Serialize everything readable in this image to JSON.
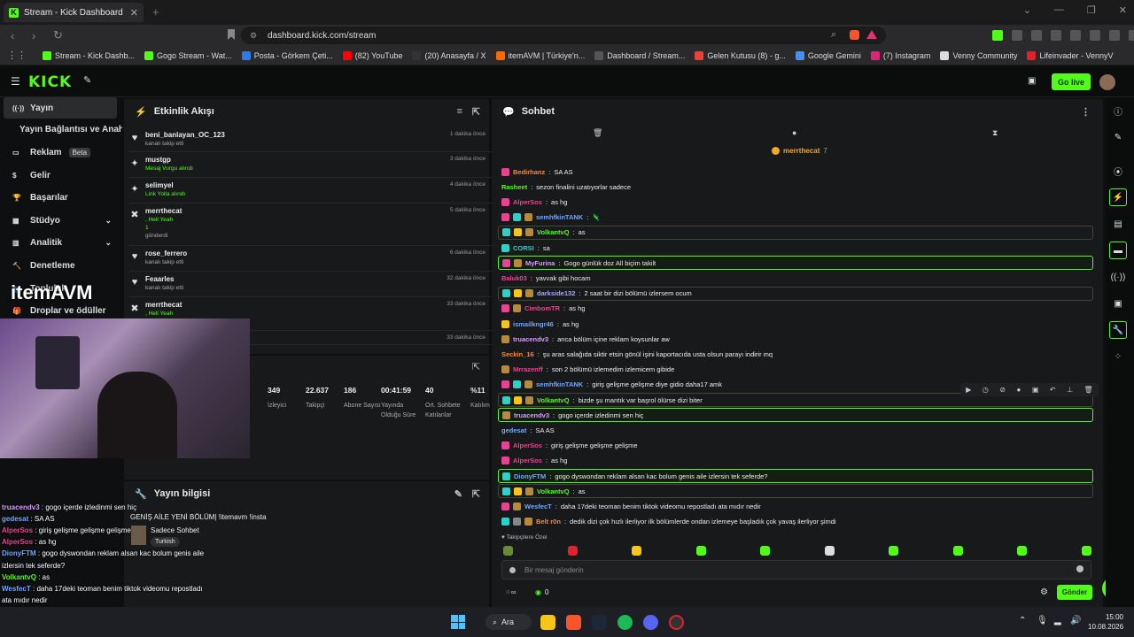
{
  "browser": {
    "tab_title": "Stream - Kick Dashboard",
    "url": "dashboard.kick.com/stream"
  },
  "bookmarks": [
    {
      "label": "Stream - Kick Dashb...",
      "color": "#53fc18"
    },
    {
      "label": "Gogo Stream - Wat...",
      "color": "#53fc18"
    },
    {
      "label": "Posta - Görkem Çeti...",
      "color": "#2d7be5"
    },
    {
      "label": "(82) YouTube",
      "color": "#ff0000"
    },
    {
      "label": "(20) Anasayfa / X",
      "color": "#333333"
    },
    {
      "label": "itemAVM | Türkiye'n...",
      "color": "#ff6a00"
    },
    {
      "label": "Dashboard / Stream...",
      "color": "#555555"
    },
    {
      "label": "Gelen Kutusu (8) - g...",
      "color": "#ea4335"
    },
    {
      "label": "Google Gemini",
      "color": "#4a8ef0"
    },
    {
      "label": "(7) Instagram",
      "color": "#d62976"
    },
    {
      "label": "Venny Community",
      "color": "#dddddd"
    },
    {
      "label": "Lifeinvader - VennyV",
      "color": "#e0222a"
    }
  ],
  "topnav": {
    "logo": "KICK",
    "go_live": "Go live"
  },
  "sidebar": {
    "items": [
      {
        "label": "Yayın",
        "icon": "broadcast-icon",
        "active": true
      },
      {
        "label": "Yayın Bağlantısı ve Anahtarı",
        "icon": ""
      },
      {
        "label": "Reklam",
        "icon": "ad-icon",
        "badge": "Beta"
      },
      {
        "label": "Gelir",
        "icon": "dollar-icon"
      },
      {
        "label": "Başarılar",
        "icon": "trophy-icon"
      },
      {
        "label": "Stüdyo",
        "icon": "studio-icon",
        "chevron": true
      },
      {
        "label": "Analitik",
        "icon": "chart-icon",
        "chevron": true
      },
      {
        "label": "Denetleme",
        "icon": "hammer-icon"
      },
      {
        "label": "Topluluk",
        "icon": "people-icon"
      },
      {
        "label": "Droplar ve ödüller",
        "icon": "gift-icon"
      }
    ]
  },
  "activity": {
    "title": "Etkinlik Akışı",
    "rows": [
      {
        "name": "beni_banlayan_OC_123",
        "sub": "kanalı takip etti",
        "time": "1 dakika önce",
        "icon": "♥"
      },
      {
        "name": "mustgp",
        "sub": "Mesaj Vurgu alındı",
        "green": true,
        "time": "3 dakika önce",
        "icon": "✦"
      },
      {
        "name": "selimyel",
        "sub": "Link Yolla alındı",
        "green": true,
        "time": "4 dakika önce",
        "icon": "✦"
      },
      {
        "name": "merrthecat",
        "sub": ", Hell Yeah",
        "green": true,
        "extra": "1",
        "extra2": "gönderdi",
        "time": "5 dakika önce",
        "icon": "✖"
      },
      {
        "name": "rose_ferrero",
        "sub": "kanalı takip etti",
        "time": "6 dakika önce",
        "icon": "♥"
      },
      {
        "name": "Feaarles",
        "sub": "kanalı takip etti",
        "time": "32 dakika önce",
        "icon": "♥"
      },
      {
        "name": "merrthecat",
        "sub": ", Hell Yeah",
        "green": true,
        "time": "33 dakika önce",
        "icon": "✖"
      },
      {
        "name": "",
        "sub": "",
        "time": "33 dakika önce",
        "icon": ""
      }
    ]
  },
  "stats": [
    {
      "value": "349",
      "label": "İzleyici"
    },
    {
      "value": "22.637",
      "label": "Takipçi"
    },
    {
      "value": "186",
      "label": "Abone Sayısı"
    },
    {
      "value": "00:41:59",
      "label": "Yayında Olduğu Süre"
    },
    {
      "value": "40",
      "label": "Ort. Sohbete Katılanlar"
    },
    {
      "value": "%11",
      "label": "Katılım"
    }
  ],
  "stream_info": {
    "title": "Yayın bilgisi",
    "stream_title": "GENİŞ AİLE YENİ BÖLÜM| !itemavm !insta",
    "category": "Sadece Sohbet",
    "tag": "Turkish"
  },
  "chat": {
    "title": "Sohbet",
    "pinned_user": "merrthecat",
    "pinned_count": "7",
    "placeholder": "Bir mesaj gönderin",
    "send": "Gönder",
    "followers_only": "Takipçilere Özel",
    "bottom_count": "0",
    "messages": [
      {
        "user": "Bedirhanz",
        "color": "#f58a3a",
        "text": "SA AS",
        "badges": [
          "#e84393"
        ]
      },
      {
        "user": "Rasheet",
        "color": "#53fc18",
        "text": "sezon finalini uzatıyorlar sadece",
        "badges": []
      },
      {
        "user": "AlperSos",
        "color": "#e84393",
        "text": "as hg",
        "badges": [
          "#e84393"
        ]
      },
      {
        "user": "semhfkinTANK",
        "color": "#6fa8ff",
        "text": "🦎",
        "badges": [
          "#e84393",
          "#2ad2c9",
          "#b58a3c"
        ]
      },
      {
        "user": "VolkantvQ",
        "color": "#53fc18",
        "text": "as",
        "badges": [
          "#2ad2c9",
          "#f5c518",
          "#b58a3c"
        ],
        "hl": "hl2"
      },
      {
        "user": "CORSI",
        "color": "#2ad2c9",
        "text": "sa",
        "badges": [
          "#2ad2c9"
        ]
      },
      {
        "user": "MyFurina",
        "color": "#d89bff",
        "text": "Gogo günlük doz All biçim takilt",
        "badges": [
          "#e84393",
          "#b58a3c"
        ],
        "hl": "hl"
      },
      {
        "user": "Baluk03",
        "color": "#e84393",
        "text": "yavvak gibi hocam",
        "badges": []
      },
      {
        "user": "darkside132",
        "color": "#a6a6ff",
        "text": "2 saat bir dizi bölümü izlersem ocum",
        "badges": [
          "#2ad2c9",
          "#f5c518",
          "#b58a3c"
        ],
        "hl": "hl2"
      },
      {
        "user": "CimbomTR",
        "color": "#e84393",
        "text": "as hg",
        "badges": [
          "#e84393",
          "#b58a3c"
        ]
      },
      {
        "user": "ismailkngr46",
        "color": "#6fa8ff",
        "text": "as hg",
        "badges": [
          "#f5c518"
        ]
      },
      {
        "user": "truacendv3",
        "color": "#d89bff",
        "text": "anca bölüm içine reklam koysunlar aw",
        "badges": [
          "#b58a3c"
        ]
      },
      {
        "user": "Seckin_16",
        "color": "#f58a3a",
        "text": "şu aras salağıda siktir etsin gönül işini kaportacıda usta olsun parayı indirir mq",
        "badges": []
      },
      {
        "user": "Mrrazenff",
        "color": "#e84393",
        "text": "son 2 bölümü izlemedim izlemicem gibide",
        "badges": [
          "#b58a3c"
        ]
      },
      {
        "user": "semhfkinTANK",
        "color": "#6fa8ff",
        "text": "giriş gelişme gelişme diye gidio daha17 amk",
        "badges": [
          "#e84393",
          "#2ad2c9",
          "#b58a3c"
        ]
      },
      {
        "user": "VolkantvQ",
        "color": "#53fc18",
        "text": "bizde şu mantık var başrol ölürse dizi biter",
        "badges": [
          "#2ad2c9",
          "#f5c518",
          "#b58a3c"
        ],
        "hl": "hl2"
      },
      {
        "user": "truacendv3",
        "color": "#d89bff",
        "text": "gogo içerde izledinmi sen hiç",
        "badges": [
          "#b58a3c"
        ],
        "hl": "hl"
      },
      {
        "user": "gedesat",
        "color": "#6fa8ff",
        "text": "SA AS",
        "badges": []
      },
      {
        "user": "AlperSos",
        "color": "#e84393",
        "text": "giriş gelişme gelişme gelişme",
        "badges": [
          "#e84393"
        ]
      },
      {
        "user": "AlperSos",
        "color": "#e84393",
        "text": "as hg",
        "badges": [
          "#e84393"
        ]
      },
      {
        "user": "DionyFTM",
        "color": "#6fa8ff",
        "text": "gogo dyswondan reklam alsan kac bolum genis aile izlersin tek seferde?",
        "badges": [
          "#2ad2c9"
        ],
        "hl": "hl"
      },
      {
        "user": "VolkantvQ",
        "color": "#53fc18",
        "text": "as",
        "badges": [
          "#2ad2c9",
          "#f5c518",
          "#b58a3c"
        ],
        "hl": "hl2"
      },
      {
        "user": "WesfecT",
        "color": "#6fa8ff",
        "text": "daha 17deki teoman benim tiktok videomu repostladı ata mıdır nedir",
        "badges": [
          "#e84393",
          "#b58a3c"
        ]
      },
      {
        "user": "Belt r0n",
        "color": "#f58a3a",
        "text": "dedik dizi çok hızlı ilerliyor ilk bölümlerde ondan izlemeye başladık çok yavaş ilerliyor şimdi",
        "badges": [
          "#2ad2c9",
          "#888888",
          "#b58a3c"
        ]
      }
    ]
  },
  "overlay": {
    "brand": "itemAVM",
    "lines": [
      {
        "user": "truacendv3",
        "color": "#d89bff",
        "text": "gogo içerde izledinmi sen hiç"
      },
      {
        "user": "gedesat",
        "color": "#6fa8ff",
        "text": "SA AS"
      },
      {
        "user": "AlperSos",
        "color": "#e84393",
        "text": "giriş gelişme gelişme gelişme"
      },
      {
        "user": "AlperSos",
        "color": "#e84393",
        "text": "as hg"
      },
      {
        "user": "DionyFTM",
        "color": "#6fa8ff",
        "text": "gogo dyswondan reklam alsan kac bolum genis aile"
      },
      {
        "user": "",
        "color": "#ffffff",
        "text": "izlersin tek seferde?"
      },
      {
        "user": "VolkantvQ",
        "color": "#53fc18",
        "text": "as"
      },
      {
        "user": "WesfecT",
        "color": "#6fa8ff",
        "text": "daha 17deki teoman benim tiktok videomu repostladı"
      },
      {
        "user": "",
        "color": "#ffffff",
        "text": "ata mıdır nedir"
      },
      {
        "user": "Beltr0n",
        "color": "#f58a3a",
        "text": "dedik dizi çok hızlı ilerliyor ilk bölümlerde ondan"
      },
      {
        "user": "",
        "color": "#ffffff",
        "text": "izlemeye başladık çok yavaş ilerliyor şimdi"
      }
    ]
  },
  "taskbar": {
    "search": "Ara",
    "time": "15:00",
    "date": "10.08.2026"
  }
}
